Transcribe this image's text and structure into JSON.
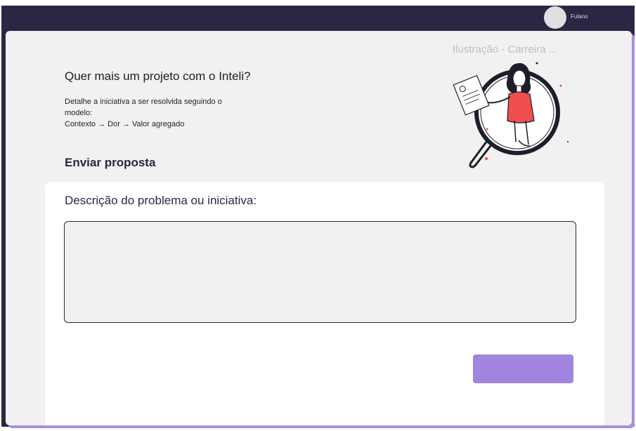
{
  "header": {
    "user_name": "Fulano"
  },
  "hero": {
    "title": "Quer mais um projeto com o Inteli?",
    "description_lines": [
      "Detalhe a iniciativa a ser resolvida seguindo o",
      "modelo:",
      "Contexto → Dor → Valor agregado"
    ],
    "illustration_caption": "Ilustração - Carreira ..."
  },
  "form": {
    "section_title": "Enviar proposta",
    "field_label": "Descrição do problema ou iniciativa:",
    "field_value": "",
    "submit_label": ""
  },
  "colors": {
    "topbar": "#2d2544",
    "panel": "#f1f1f1",
    "accent": "#a184e0",
    "shadow": "#a98fe0",
    "illustration_red": "#f04d4d"
  },
  "icons": {
    "illustration": "woman-with-magnifying-glass-and-document"
  }
}
